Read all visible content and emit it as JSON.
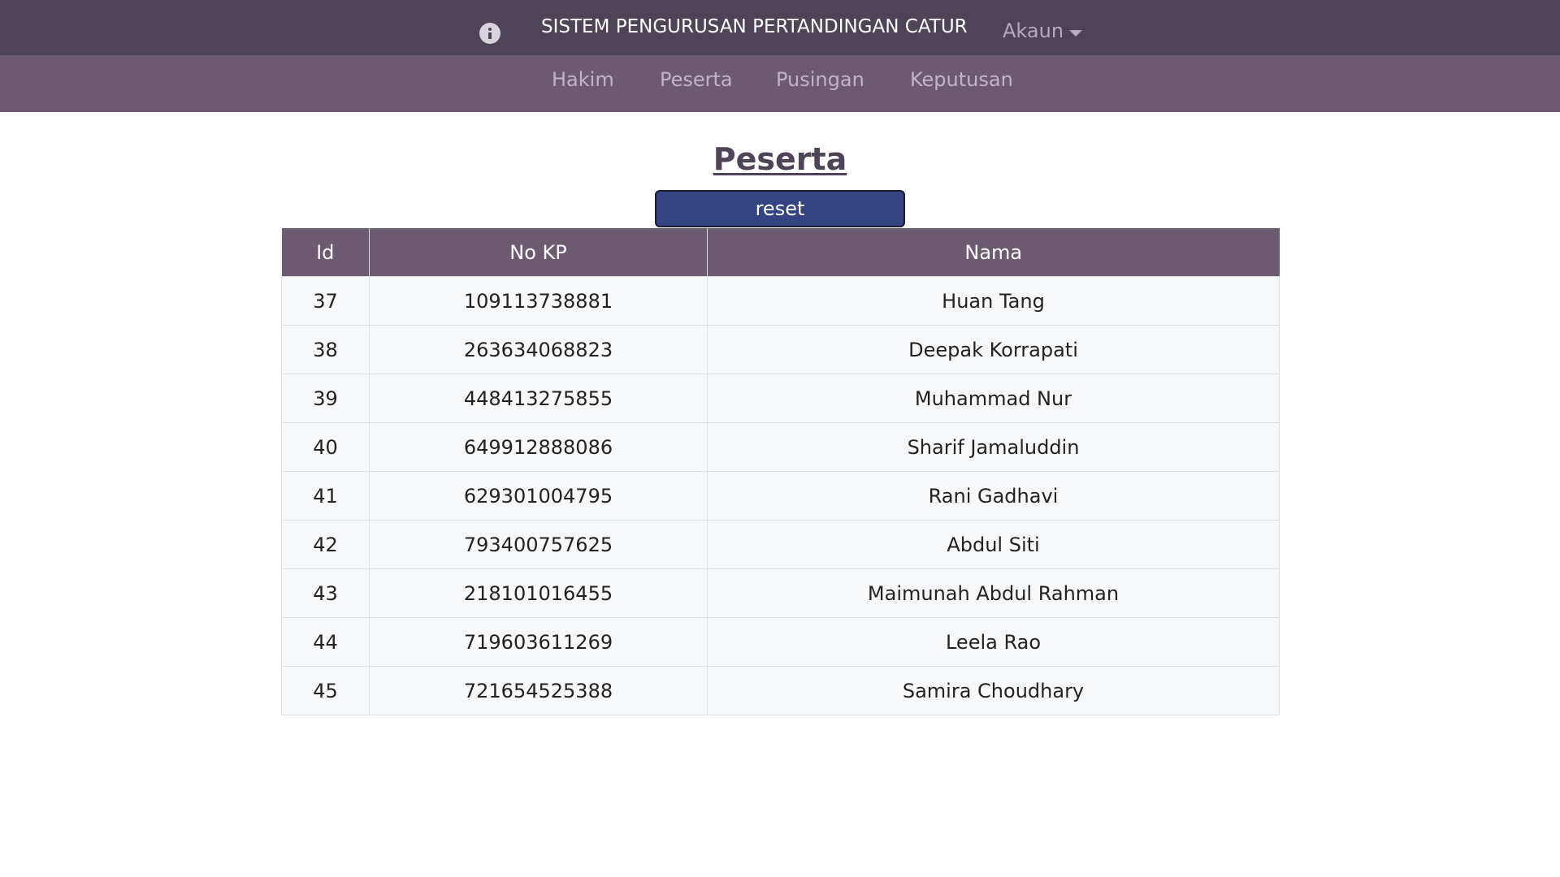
{
  "header": {
    "title": "SISTEM PENGURUSAN PERTANDINGAN CATUR",
    "account_label": "Akaun",
    "info_icon": "info-circle-icon",
    "caret_icon": "chevron-down-icon"
  },
  "nav": {
    "items": [
      {
        "label": "Hakim"
      },
      {
        "label": "Peserta"
      },
      {
        "label": "Pusingan"
      },
      {
        "label": "Keputusan"
      }
    ]
  },
  "main": {
    "title": "Peserta",
    "reset_label": "reset",
    "table": {
      "columns": [
        "Id",
        "No KP",
        "Nama"
      ],
      "rows": [
        {
          "id": "37",
          "no_kp": "109113738881",
          "nama": "Huan Tang"
        },
        {
          "id": "38",
          "no_kp": "263634068823",
          "nama": "Deepak Korrapati"
        },
        {
          "id": "39",
          "no_kp": "448413275855",
          "nama": "Muhammad Nur"
        },
        {
          "id": "40",
          "no_kp": "649912888086",
          "nama": "Sharif Jamaluddin"
        },
        {
          "id": "41",
          "no_kp": "629301004795",
          "nama": "Rani Gadhavi"
        },
        {
          "id": "42",
          "no_kp": "793400757625",
          "nama": "Abdul Siti"
        },
        {
          "id": "43",
          "no_kp": "218101016455",
          "nama": "Maimunah Abdul Rahman"
        },
        {
          "id": "44",
          "no_kp": "719603611269",
          "nama": "Leela Rao"
        },
        {
          "id": "45",
          "no_kp": "721654525388",
          "nama": "Samira Choudhary"
        }
      ]
    }
  },
  "colors": {
    "header_bg": "#4f4358",
    "subnav_bg": "#6c5b70",
    "button_bg": "#344483",
    "row_bg": "#f7f8fa"
  }
}
